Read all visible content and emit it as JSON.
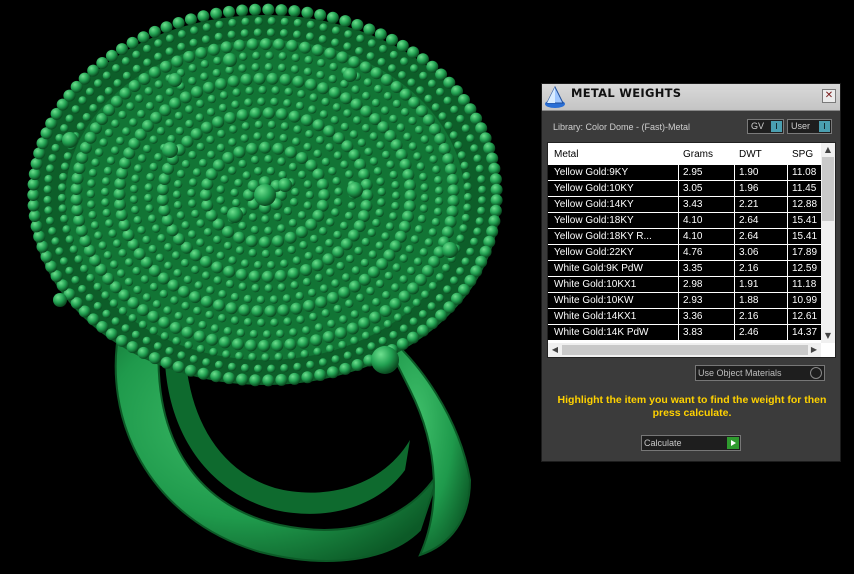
{
  "colors": {
    "ring": "#1f9a4c",
    "ring_dark": "#0c5a27",
    "ring_light": "#52c97a",
    "hint": "#ffd200",
    "indicator": "#4a9fb0"
  },
  "viewport": {
    "subject": "3D jewelry ring model (green wax render)"
  },
  "panel": {
    "title": "METAL WEIGHTS",
    "title_icon": "pyramid-app-icon",
    "close_glyph": "✕",
    "library": "Library: Color Dome - (Fast)-Metal",
    "gv_label": "GV",
    "gv_indicator": "I",
    "user_label": "User",
    "user_indicator": "I",
    "table": {
      "columns": [
        "Metal",
        "Grams",
        "DWT",
        "SPG"
      ],
      "rows": [
        [
          "Yellow Gold:9KY",
          "2.95",
          "1.90",
          "11.08"
        ],
        [
          "Yellow Gold:10KY",
          "3.05",
          "1.96",
          "11.45"
        ],
        [
          "Yellow Gold:14KY",
          "3.43",
          "2.21",
          "12.88"
        ],
        [
          "Yellow Gold:18KY",
          "4.10",
          "2.64",
          "15.41"
        ],
        [
          "Yellow Gold:18KY R...",
          "4.10",
          "2.64",
          "15.41"
        ],
        [
          "Yellow Gold:22KY",
          "4.76",
          "3.06",
          "17.89"
        ],
        [
          "White Gold:9K PdW",
          "3.35",
          "2.16",
          "12.59"
        ],
        [
          "White Gold:10KX1",
          "2.98",
          "1.91",
          "11.18"
        ],
        [
          "White Gold:10KW",
          "2.93",
          "1.88",
          "10.99"
        ],
        [
          "White Gold:14KX1",
          "3.36",
          "2.16",
          "12.61"
        ],
        [
          "White Gold:14K PdW",
          "3.83",
          "2.46",
          "14.37"
        ]
      ]
    },
    "use_object_materials": "Use Object Materials",
    "hint": "Highlight the item you want to find the weight for then press calculate.",
    "calculate": "Calculate"
  }
}
